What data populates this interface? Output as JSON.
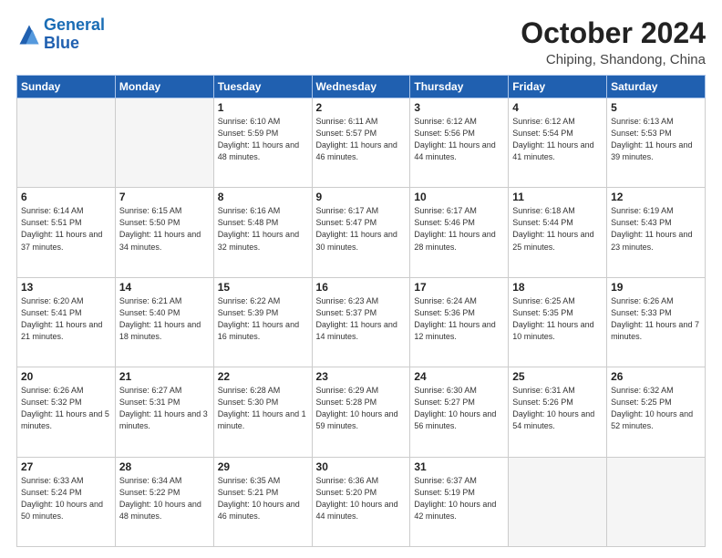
{
  "header": {
    "logo_line1": "General",
    "logo_line2": "Blue",
    "month_year": "October 2024",
    "location": "Chiping, Shandong, China"
  },
  "days_of_week": [
    "Sunday",
    "Monday",
    "Tuesday",
    "Wednesday",
    "Thursday",
    "Friday",
    "Saturday"
  ],
  "weeks": [
    [
      {
        "day": "",
        "sunrise": "",
        "sunset": "",
        "daylight": ""
      },
      {
        "day": "",
        "sunrise": "",
        "sunset": "",
        "daylight": ""
      },
      {
        "day": "1",
        "sunrise": "Sunrise: 6:10 AM",
        "sunset": "Sunset: 5:59 PM",
        "daylight": "Daylight: 11 hours and 48 minutes."
      },
      {
        "day": "2",
        "sunrise": "Sunrise: 6:11 AM",
        "sunset": "Sunset: 5:57 PM",
        "daylight": "Daylight: 11 hours and 46 minutes."
      },
      {
        "day": "3",
        "sunrise": "Sunrise: 6:12 AM",
        "sunset": "Sunset: 5:56 PM",
        "daylight": "Daylight: 11 hours and 44 minutes."
      },
      {
        "day": "4",
        "sunrise": "Sunrise: 6:12 AM",
        "sunset": "Sunset: 5:54 PM",
        "daylight": "Daylight: 11 hours and 41 minutes."
      },
      {
        "day": "5",
        "sunrise": "Sunrise: 6:13 AM",
        "sunset": "Sunset: 5:53 PM",
        "daylight": "Daylight: 11 hours and 39 minutes."
      }
    ],
    [
      {
        "day": "6",
        "sunrise": "Sunrise: 6:14 AM",
        "sunset": "Sunset: 5:51 PM",
        "daylight": "Daylight: 11 hours and 37 minutes."
      },
      {
        "day": "7",
        "sunrise": "Sunrise: 6:15 AM",
        "sunset": "Sunset: 5:50 PM",
        "daylight": "Daylight: 11 hours and 34 minutes."
      },
      {
        "day": "8",
        "sunrise": "Sunrise: 6:16 AM",
        "sunset": "Sunset: 5:48 PM",
        "daylight": "Daylight: 11 hours and 32 minutes."
      },
      {
        "day": "9",
        "sunrise": "Sunrise: 6:17 AM",
        "sunset": "Sunset: 5:47 PM",
        "daylight": "Daylight: 11 hours and 30 minutes."
      },
      {
        "day": "10",
        "sunrise": "Sunrise: 6:17 AM",
        "sunset": "Sunset: 5:46 PM",
        "daylight": "Daylight: 11 hours and 28 minutes."
      },
      {
        "day": "11",
        "sunrise": "Sunrise: 6:18 AM",
        "sunset": "Sunset: 5:44 PM",
        "daylight": "Daylight: 11 hours and 25 minutes."
      },
      {
        "day": "12",
        "sunrise": "Sunrise: 6:19 AM",
        "sunset": "Sunset: 5:43 PM",
        "daylight": "Daylight: 11 hours and 23 minutes."
      }
    ],
    [
      {
        "day": "13",
        "sunrise": "Sunrise: 6:20 AM",
        "sunset": "Sunset: 5:41 PM",
        "daylight": "Daylight: 11 hours and 21 minutes."
      },
      {
        "day": "14",
        "sunrise": "Sunrise: 6:21 AM",
        "sunset": "Sunset: 5:40 PM",
        "daylight": "Daylight: 11 hours and 18 minutes."
      },
      {
        "day": "15",
        "sunrise": "Sunrise: 6:22 AM",
        "sunset": "Sunset: 5:39 PM",
        "daylight": "Daylight: 11 hours and 16 minutes."
      },
      {
        "day": "16",
        "sunrise": "Sunrise: 6:23 AM",
        "sunset": "Sunset: 5:37 PM",
        "daylight": "Daylight: 11 hours and 14 minutes."
      },
      {
        "day": "17",
        "sunrise": "Sunrise: 6:24 AM",
        "sunset": "Sunset: 5:36 PM",
        "daylight": "Daylight: 11 hours and 12 minutes."
      },
      {
        "day": "18",
        "sunrise": "Sunrise: 6:25 AM",
        "sunset": "Sunset: 5:35 PM",
        "daylight": "Daylight: 11 hours and 10 minutes."
      },
      {
        "day": "19",
        "sunrise": "Sunrise: 6:26 AM",
        "sunset": "Sunset: 5:33 PM",
        "daylight": "Daylight: 11 hours and 7 minutes."
      }
    ],
    [
      {
        "day": "20",
        "sunrise": "Sunrise: 6:26 AM",
        "sunset": "Sunset: 5:32 PM",
        "daylight": "Daylight: 11 hours and 5 minutes."
      },
      {
        "day": "21",
        "sunrise": "Sunrise: 6:27 AM",
        "sunset": "Sunset: 5:31 PM",
        "daylight": "Daylight: 11 hours and 3 minutes."
      },
      {
        "day": "22",
        "sunrise": "Sunrise: 6:28 AM",
        "sunset": "Sunset: 5:30 PM",
        "daylight": "Daylight: 11 hours and 1 minute."
      },
      {
        "day": "23",
        "sunrise": "Sunrise: 6:29 AM",
        "sunset": "Sunset: 5:28 PM",
        "daylight": "Daylight: 10 hours and 59 minutes."
      },
      {
        "day": "24",
        "sunrise": "Sunrise: 6:30 AM",
        "sunset": "Sunset: 5:27 PM",
        "daylight": "Daylight: 10 hours and 56 minutes."
      },
      {
        "day": "25",
        "sunrise": "Sunrise: 6:31 AM",
        "sunset": "Sunset: 5:26 PM",
        "daylight": "Daylight: 10 hours and 54 minutes."
      },
      {
        "day": "26",
        "sunrise": "Sunrise: 6:32 AM",
        "sunset": "Sunset: 5:25 PM",
        "daylight": "Daylight: 10 hours and 52 minutes."
      }
    ],
    [
      {
        "day": "27",
        "sunrise": "Sunrise: 6:33 AM",
        "sunset": "Sunset: 5:24 PM",
        "daylight": "Daylight: 10 hours and 50 minutes."
      },
      {
        "day": "28",
        "sunrise": "Sunrise: 6:34 AM",
        "sunset": "Sunset: 5:22 PM",
        "daylight": "Daylight: 10 hours and 48 minutes."
      },
      {
        "day": "29",
        "sunrise": "Sunrise: 6:35 AM",
        "sunset": "Sunset: 5:21 PM",
        "daylight": "Daylight: 10 hours and 46 minutes."
      },
      {
        "day": "30",
        "sunrise": "Sunrise: 6:36 AM",
        "sunset": "Sunset: 5:20 PM",
        "daylight": "Daylight: 10 hours and 44 minutes."
      },
      {
        "day": "31",
        "sunrise": "Sunrise: 6:37 AM",
        "sunset": "Sunset: 5:19 PM",
        "daylight": "Daylight: 10 hours and 42 minutes."
      },
      {
        "day": "",
        "sunrise": "",
        "sunset": "",
        "daylight": ""
      },
      {
        "day": "",
        "sunrise": "",
        "sunset": "",
        "daylight": ""
      }
    ]
  ]
}
